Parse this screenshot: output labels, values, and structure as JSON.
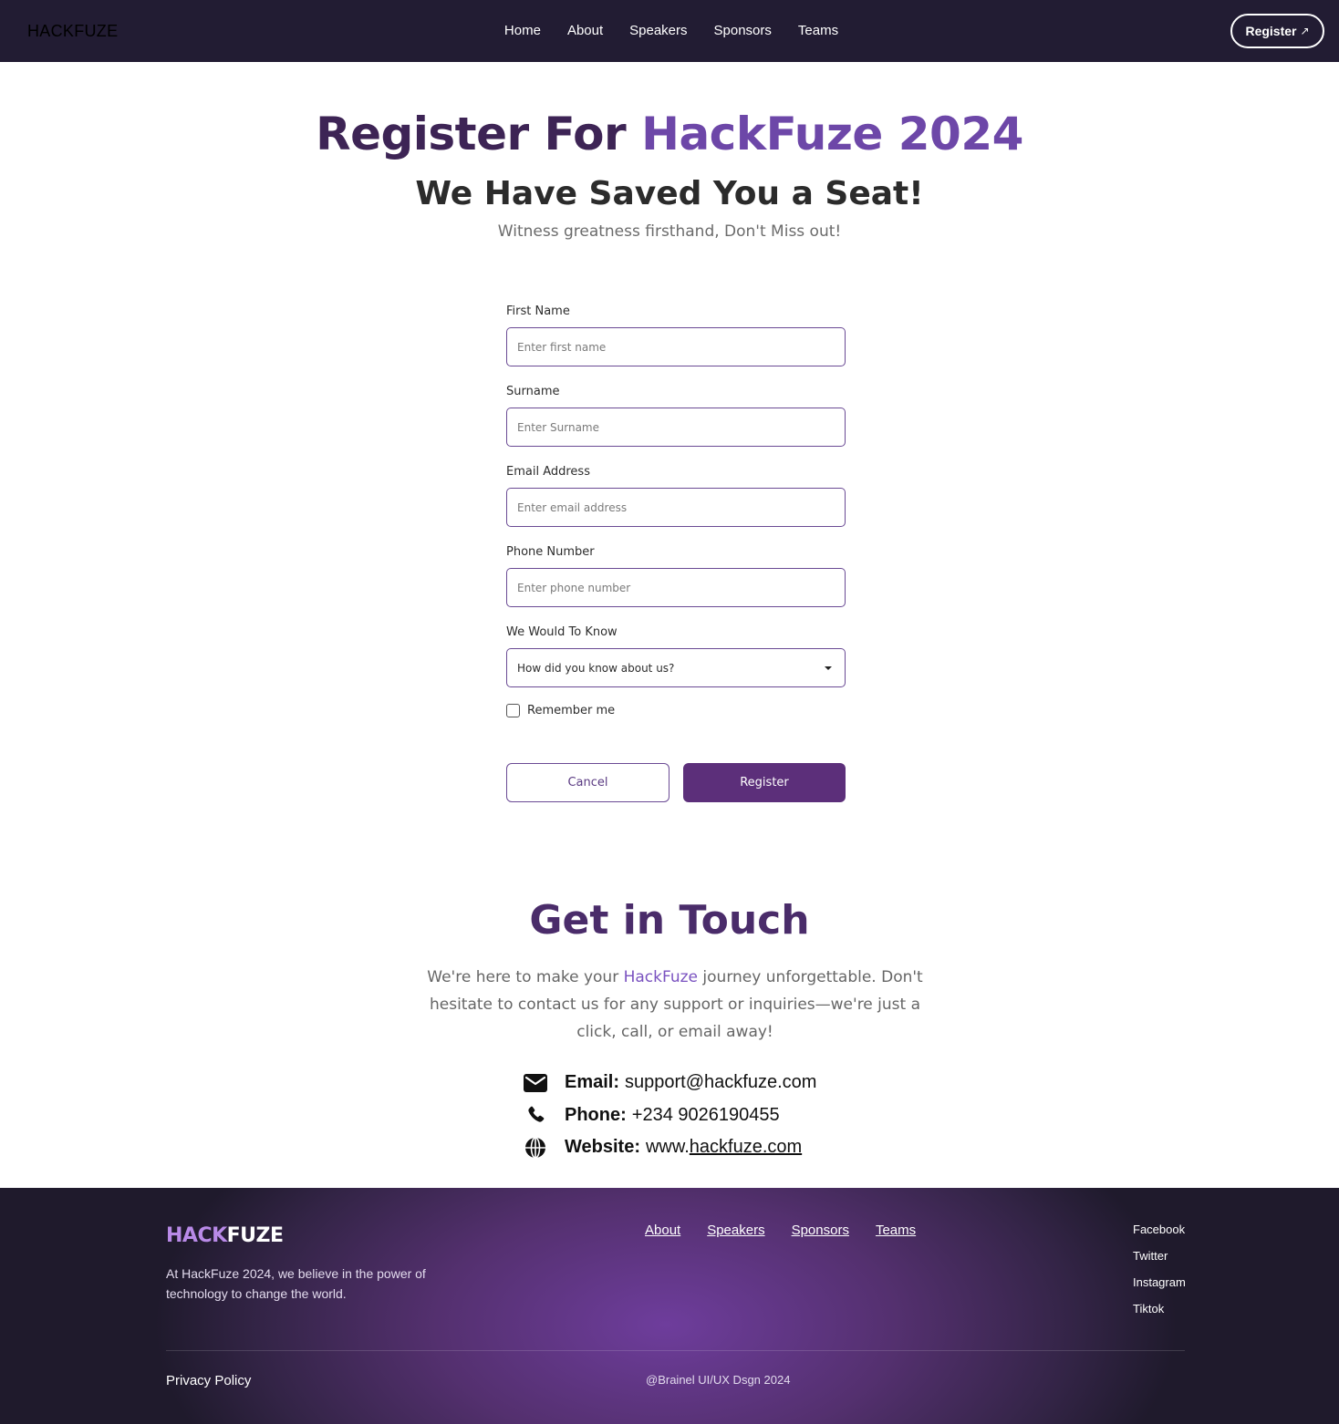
{
  "nav": {
    "logo": "HACKFUZE",
    "links": [
      "Home",
      "About",
      "Speakers",
      "Sponsors",
      "Teams"
    ],
    "cta_label": "Register",
    "cta_icon": "arrow-up-right-icon"
  },
  "hero": {
    "title_part1": "Register For ",
    "title_part2": "HackFuze 2024",
    "subtitle": "We Have Saved You a Seat!",
    "tagline": "Witness greatness firsthand, Don't Miss out!"
  },
  "form": {
    "first_name": {
      "label": "First Name",
      "placeholder": "Enter first name",
      "value": ""
    },
    "surname": {
      "label": "Surname",
      "placeholder": "Enter Surname",
      "value": ""
    },
    "email": {
      "label": "Email Address",
      "placeholder": "Enter email address",
      "value": ""
    },
    "phone": {
      "label": "Phone Number",
      "placeholder": "Enter phone number",
      "value": ""
    },
    "source": {
      "label": "We Would To Know",
      "selected": "How did you know about us?"
    },
    "remember_label": "Remember me",
    "remember_checked": false,
    "cancel_label": "Cancel",
    "register_label": "Register"
  },
  "contact": {
    "title": "Get in Touch",
    "text_before": "We're here to make your ",
    "text_highlight": "HackFuze",
    "text_after": " journey unforgettable. Don't hesitate to contact us for any support or inquiries—we're just a click, call, or email away!",
    "email_label": "Email:",
    "email_value": "support@hackfuze.com",
    "phone_label": "Phone:",
    "phone_value": "+234 9026190455",
    "website_label": "Website:",
    "website_prefix": "www.",
    "website_link": "hackfuze.com",
    "icons": [
      "envelope-icon",
      "phone-icon",
      "globe-icon"
    ]
  },
  "footer": {
    "logo_part1": "HACK",
    "logo_part2": "FUZE",
    "about": "At HackFuze 2024, we believe in the power of technology to change the world.",
    "links": [
      "About",
      "Speakers",
      "Sponsors",
      "Teams"
    ],
    "social": [
      "Facebook",
      "Twitter",
      "Instagram",
      "Tiktok"
    ],
    "privacy": "Privacy Policy",
    "copyright": "@Brainel UI/UX Dsgn 2024"
  },
  "colors": {
    "nav_bg": "#221c33",
    "title_dark": "#3d2455",
    "title_accent": "#6d47a8",
    "button_primary": "#5c2f7a",
    "input_border": "#6a4a94",
    "footer_glow": "#6e3d9c"
  }
}
